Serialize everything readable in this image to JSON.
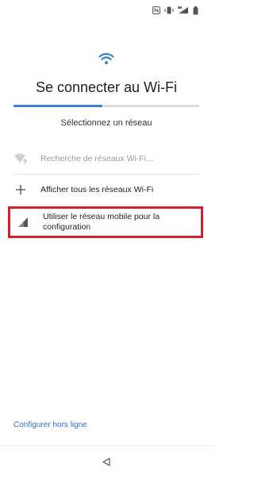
{
  "status_bar": {
    "icons": [
      "nfc-icon",
      "vibrate-icon",
      "mobile-data-icon",
      "battery-icon"
    ]
  },
  "header": {
    "icon": "wifi-icon",
    "title": "Se connecter au Wi-Fi",
    "progress": 0.48
  },
  "subtitle": "Sélectionnez un réseau",
  "network_list": {
    "searching": {
      "icon": "wifi-searching-icon",
      "label": "Recherche de réseaux Wi-Fi…"
    },
    "show_all": {
      "icon": "plus-icon",
      "label": "Afficher tous les réseaux Wi-Fi"
    },
    "mobile": {
      "icon": "cell-signal-icon",
      "label": "Utiliser le réseau mobile pour la configuration"
    }
  },
  "footer": {
    "offline_label": "Configurer hors ligne"
  },
  "nav": {
    "back_icon": "back-triangle-icon"
  },
  "colors": {
    "accent": "#3f7fd0",
    "highlight": "#d2202f",
    "link": "#2e6fbf"
  }
}
